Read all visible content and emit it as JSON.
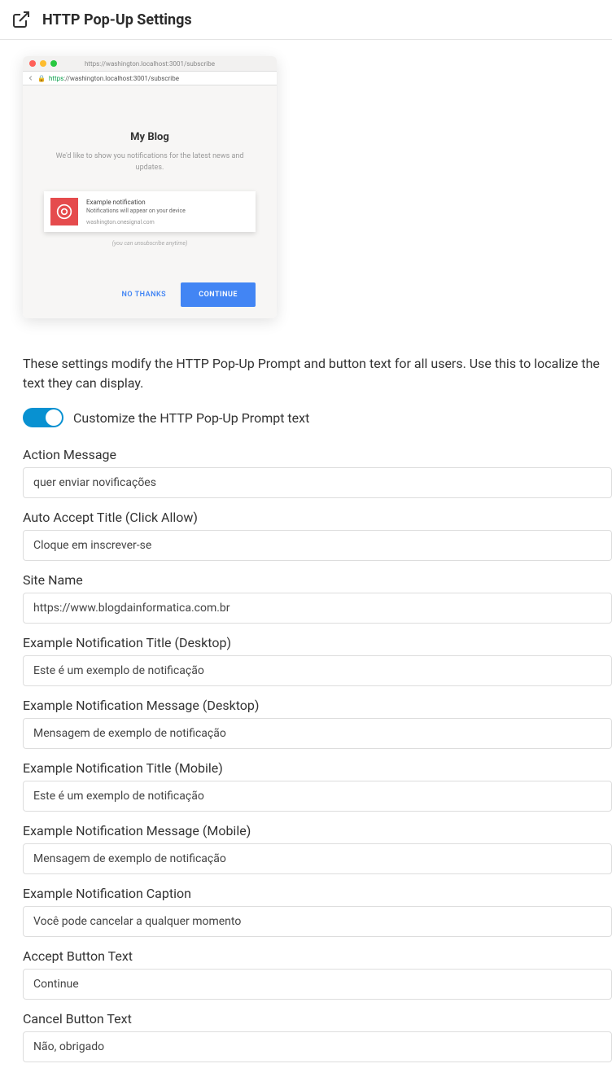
{
  "header": {
    "title": "HTTP Pop-Up Settings"
  },
  "preview": {
    "top_url": "https://washington.localhost:3001/subscribe",
    "addr_proto": "https",
    "addr_rest": "://washington.localhost:3001/subscribe",
    "blog_title": "My Blog",
    "blog_msg": "We'd like to show you notifications for the latest news and updates.",
    "notif_title": "Example notification",
    "notif_msg": "Notifications will appear on your device",
    "notif_domain": "washington.onesignal.com",
    "unsubscribe": "(you can unsubscribe anytime)",
    "btn_nothanks": "NO THANKS",
    "btn_continue": "CONTINUE"
  },
  "description": "These settings modify the HTTP Pop-Up Prompt and button text for all users. Use this to localize the text they can display.",
  "toggle_label": "Customize the HTTP Pop-Up Prompt text",
  "fields": {
    "action_message": {
      "label": "Action Message",
      "value": "quer enviar novificações"
    },
    "auto_accept": {
      "label": "Auto Accept Title (Click Allow)",
      "value": "Cloque em inscrever-se"
    },
    "site_name": {
      "label": "Site Name",
      "value": "https://www.blogdainformatica.com.br"
    },
    "ex_title_desktop": {
      "label": "Example Notification Title (Desktop)",
      "value": "Este é um exemplo de notificação"
    },
    "ex_msg_desktop": {
      "label": "Example Notification Message (Desktop)",
      "value": "Mensagem de exemplo de notificação"
    },
    "ex_title_mobile": {
      "label": "Example Notification Title (Mobile)",
      "value": "Este é um exemplo de notificação"
    },
    "ex_msg_mobile": {
      "label": "Example Notification Message (Mobile)",
      "value": "Mensagem de exemplo de notificação"
    },
    "ex_caption": {
      "label": "Example Notification Caption",
      "value": "Você pode cancelar a qualquer momento"
    },
    "accept_btn": {
      "label": "Accept Button Text",
      "value": "Continue"
    },
    "cancel_btn": {
      "label": "Cancel Button Text",
      "value": "Não, obrigado"
    }
  }
}
